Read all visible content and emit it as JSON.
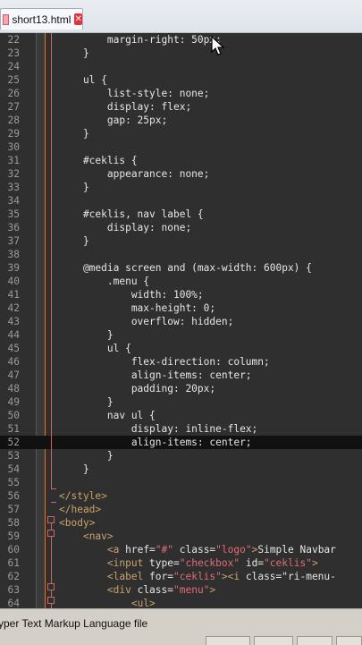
{
  "tab": {
    "title": "short13.html",
    "close_symbol": "✕"
  },
  "status": {
    "text": "yper Text Markup Language file"
  },
  "lines": [
    {
      "n": "22",
      "text": "        margin-right: 50px;"
    },
    {
      "n": "23",
      "text": "    }"
    },
    {
      "n": "24",
      "text": ""
    },
    {
      "n": "25",
      "text": "    ul {"
    },
    {
      "n": "26",
      "text": "        list-style: none;"
    },
    {
      "n": "27",
      "text": "        display: flex;"
    },
    {
      "n": "28",
      "text": "        gap: 25px;"
    },
    {
      "n": "29",
      "text": "    }"
    },
    {
      "n": "30",
      "text": ""
    },
    {
      "n": "31",
      "text": "    #ceklis {"
    },
    {
      "n": "32",
      "text": "        appearance: none;"
    },
    {
      "n": "33",
      "text": "    }"
    },
    {
      "n": "34",
      "text": ""
    },
    {
      "n": "35",
      "text": "    #ceklis, nav label {"
    },
    {
      "n": "36",
      "text": "        display: none;"
    },
    {
      "n": "37",
      "text": "    }"
    },
    {
      "n": "38",
      "text": ""
    },
    {
      "n": "39",
      "text": "    @media screen and (max-width: 600px) {"
    },
    {
      "n": "40",
      "text": "        .menu {"
    },
    {
      "n": "41",
      "text": "            width: 100%;"
    },
    {
      "n": "42",
      "text": "            max-height: 0;"
    },
    {
      "n": "43",
      "text": "            overflow: hidden;"
    },
    {
      "n": "44",
      "text": "        }"
    },
    {
      "n": "45",
      "text": "        ul {"
    },
    {
      "n": "46",
      "text": "            flex-direction: column;"
    },
    {
      "n": "47",
      "text": "            align-items: center;"
    },
    {
      "n": "48",
      "text": "            padding: 20px;"
    },
    {
      "n": "49",
      "text": "        }"
    },
    {
      "n": "50",
      "text": "        nav ul {"
    },
    {
      "n": "51",
      "text": "            display: inline-flex;"
    },
    {
      "n": "52",
      "text": "            align-items: center;"
    },
    {
      "n": "53",
      "text": "        }"
    },
    {
      "n": "54",
      "text": "    }"
    },
    {
      "n": "55",
      "text": ""
    },
    {
      "n": "56",
      "text": "</style>"
    },
    {
      "n": "57",
      "text": "</head>"
    },
    {
      "n": "58",
      "text": "<body>"
    },
    {
      "n": "59",
      "text": "    <nav>"
    },
    {
      "n": "60",
      "text": "        <a href=\"#\" class=\"logo\">Simple Navbar"
    },
    {
      "n": "61",
      "text": "        <input type=\"checkbox\" id=\"ceklis\">"
    },
    {
      "n": "62",
      "text": "        <label for=\"ceklis\"><i class=\"ri-menu-"
    },
    {
      "n": "63",
      "text": "        <div class=\"menu\">"
    },
    {
      "n": "64",
      "text": "            <ul>"
    }
  ],
  "current_line": "52"
}
